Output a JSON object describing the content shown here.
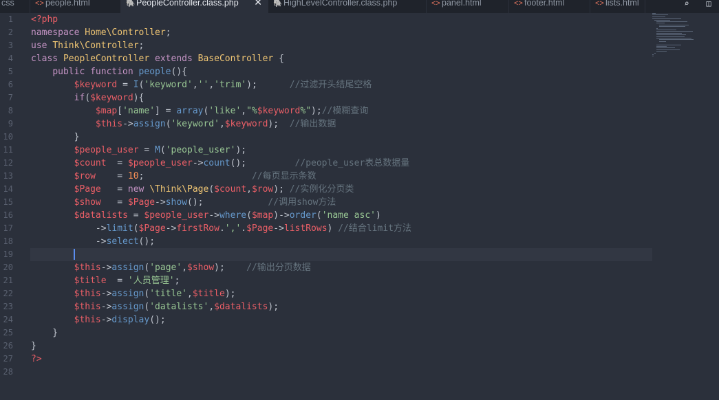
{
  "tabs": [
    {
      "label": "css",
      "icon": "",
      "active": false
    },
    {
      "label": "people.html",
      "icon": "html",
      "active": false
    },
    {
      "label": "PeopleController.class.php",
      "icon": "php",
      "active": true
    },
    {
      "label": "HighLevelController.class.php",
      "icon": "php",
      "active": false
    },
    {
      "label": "panel.html",
      "icon": "html",
      "active": false
    },
    {
      "label": "footer.html",
      "icon": "html",
      "active": false
    },
    {
      "label": "lists.html",
      "icon": "html",
      "active": false
    }
  ],
  "close_glyph": "✕",
  "html_icon_glyph": "<>",
  "php_icon_glyph": "🐘",
  "line_numbers": [
    "1",
    "2",
    "3",
    "4",
    "5",
    "6",
    "7",
    "8",
    "9",
    "10",
    "11",
    "12",
    "13",
    "14",
    "15",
    "16",
    "17",
    "18",
    "19",
    "20",
    "21",
    "22",
    "23",
    "24",
    "25",
    "26",
    "27",
    "28"
  ],
  "code_lines": [
    [
      [
        "tag",
        "<?php"
      ]
    ],
    [
      [
        "kw",
        "namespace "
      ],
      [
        "cls",
        "Home\\Controller"
      ],
      [
        "plain",
        ";"
      ]
    ],
    [
      [
        "kw",
        "use "
      ],
      [
        "cls",
        "Think\\Controller"
      ],
      [
        "plain",
        ";"
      ]
    ],
    [
      [
        "kw",
        "class "
      ],
      [
        "cls",
        "PeopleController "
      ],
      [
        "kw",
        "extends "
      ],
      [
        "cls",
        "BaseController "
      ],
      [
        "plain",
        "{"
      ]
    ],
    [
      [
        "plain",
        "    "
      ],
      [
        "kw",
        "public function "
      ],
      [
        "fn",
        "people"
      ],
      [
        "plain",
        "(){"
      ]
    ],
    [
      [
        "plain",
        "        "
      ],
      [
        "var",
        "$keyword"
      ],
      [
        "plain",
        " = "
      ],
      [
        "fn",
        "I"
      ],
      [
        "plain",
        "("
      ],
      [
        "str",
        "'keyword'"
      ],
      [
        "plain",
        ","
      ],
      [
        "str",
        "''"
      ],
      [
        "plain",
        ","
      ],
      [
        "str",
        "'trim'"
      ],
      [
        "plain",
        ");      "
      ],
      [
        "cm",
        "//过滤开头结尾空格"
      ]
    ],
    [
      [
        "plain",
        "        "
      ],
      [
        "kw",
        "if"
      ],
      [
        "plain",
        "("
      ],
      [
        "var",
        "$keyword"
      ],
      [
        "plain",
        "){"
      ]
    ],
    [
      [
        "plain",
        "            "
      ],
      [
        "var",
        "$map"
      ],
      [
        "plain",
        "["
      ],
      [
        "str",
        "'name'"
      ],
      [
        "plain",
        "] = "
      ],
      [
        "fn",
        "array"
      ],
      [
        "plain",
        "("
      ],
      [
        "str",
        "'like'"
      ],
      [
        "plain",
        ","
      ],
      [
        "str",
        "\"%"
      ],
      [
        "var",
        "$keyword"
      ],
      [
        "str",
        "%\""
      ],
      [
        "plain",
        ");"
      ],
      [
        "cm",
        "//模糊查询"
      ]
    ],
    [
      [
        "plain",
        "            "
      ],
      [
        "var",
        "$this"
      ],
      [
        "plain",
        "->"
      ],
      [
        "fn",
        "assign"
      ],
      [
        "plain",
        "("
      ],
      [
        "str",
        "'keyword'"
      ],
      [
        "plain",
        ","
      ],
      [
        "var",
        "$keyword"
      ],
      [
        "plain",
        ");  "
      ],
      [
        "cm",
        "//输出数据"
      ]
    ],
    [
      [
        "plain",
        "        }"
      ]
    ],
    [
      [
        "plain",
        "        "
      ],
      [
        "var",
        "$people_user"
      ],
      [
        "plain",
        " = "
      ],
      [
        "fn",
        "M"
      ],
      [
        "plain",
        "("
      ],
      [
        "str",
        "'people_user'"
      ],
      [
        "plain",
        ");"
      ]
    ],
    [
      [
        "plain",
        "        "
      ],
      [
        "var",
        "$count"
      ],
      [
        "plain",
        "  = "
      ],
      [
        "var",
        "$people_user"
      ],
      [
        "plain",
        "->"
      ],
      [
        "fn",
        "count"
      ],
      [
        "plain",
        "();         "
      ],
      [
        "cm",
        "//people_user表总数据量"
      ]
    ],
    [
      [
        "plain",
        "        "
      ],
      [
        "var",
        "$row"
      ],
      [
        "plain",
        "    = "
      ],
      [
        "num",
        "10"
      ],
      [
        "plain",
        ";                    "
      ],
      [
        "cm",
        "//每页显示条数"
      ]
    ],
    [
      [
        "plain",
        "        "
      ],
      [
        "var",
        "$Page"
      ],
      [
        "plain",
        "   = "
      ],
      [
        "kw",
        "new "
      ],
      [
        "cls",
        "\\Think\\Page"
      ],
      [
        "plain",
        "("
      ],
      [
        "var",
        "$count"
      ],
      [
        "plain",
        ","
      ],
      [
        "var",
        "$row"
      ],
      [
        "plain",
        "); "
      ],
      [
        "cm",
        "//实例化分页类"
      ]
    ],
    [
      [
        "plain",
        "        "
      ],
      [
        "var",
        "$show"
      ],
      [
        "plain",
        "   = "
      ],
      [
        "var",
        "$Page"
      ],
      [
        "plain",
        "->"
      ],
      [
        "fn",
        "show"
      ],
      [
        "plain",
        "();            "
      ],
      [
        "cm",
        "//调用show方法"
      ]
    ],
    [
      [
        "plain",
        "        "
      ],
      [
        "var",
        "$datalists"
      ],
      [
        "plain",
        " = "
      ],
      [
        "var",
        "$people_user"
      ],
      [
        "plain",
        "->"
      ],
      [
        "fn",
        "where"
      ],
      [
        "plain",
        "("
      ],
      [
        "var",
        "$map"
      ],
      [
        "plain",
        ")->"
      ],
      [
        "fn",
        "order"
      ],
      [
        "plain",
        "("
      ],
      [
        "str",
        "'name asc'"
      ],
      [
        "plain",
        ")"
      ]
    ],
    [
      [
        "plain",
        "            ->"
      ],
      [
        "fn",
        "limit"
      ],
      [
        "plain",
        "("
      ],
      [
        "var",
        "$Page"
      ],
      [
        "plain",
        "->"
      ],
      [
        "var",
        "firstRow"
      ],
      [
        "plain",
        "."
      ],
      [
        "str",
        "','"
      ],
      [
        "plain",
        "."
      ],
      [
        "var",
        "$Page"
      ],
      [
        "plain",
        "->"
      ],
      [
        "var",
        "listRows"
      ],
      [
        "plain",
        ") "
      ],
      [
        "cm",
        "//结合limit方法"
      ]
    ],
    [
      [
        "plain",
        "            ->"
      ],
      [
        "fn",
        "select"
      ],
      [
        "plain",
        "();"
      ]
    ],
    [
      [
        "plain",
        ""
      ]
    ],
    [
      [
        "plain",
        "        "
      ],
      [
        "var",
        "$this"
      ],
      [
        "plain",
        "->"
      ],
      [
        "fn",
        "assign"
      ],
      [
        "plain",
        "("
      ],
      [
        "str",
        "'page'"
      ],
      [
        "plain",
        ","
      ],
      [
        "var",
        "$show"
      ],
      [
        "plain",
        ");    "
      ],
      [
        "cm",
        "//输出分页数据"
      ]
    ],
    [
      [
        "plain",
        "        "
      ],
      [
        "var",
        "$title"
      ],
      [
        "plain",
        "  = "
      ],
      [
        "str",
        "'人员管理'"
      ],
      [
        "plain",
        ";"
      ]
    ],
    [
      [
        "plain",
        "        "
      ],
      [
        "var",
        "$this"
      ],
      [
        "plain",
        "->"
      ],
      [
        "fn",
        "assign"
      ],
      [
        "plain",
        "("
      ],
      [
        "str",
        "'title'"
      ],
      [
        "plain",
        ","
      ],
      [
        "var",
        "$title"
      ],
      [
        "plain",
        ");"
      ]
    ],
    [
      [
        "plain",
        "        "
      ],
      [
        "var",
        "$this"
      ],
      [
        "plain",
        "->"
      ],
      [
        "fn",
        "assign"
      ],
      [
        "plain",
        "("
      ],
      [
        "str",
        "'datalists'"
      ],
      [
        "plain",
        ","
      ],
      [
        "var",
        "$datalists"
      ],
      [
        "plain",
        ");"
      ]
    ],
    [
      [
        "plain",
        "        "
      ],
      [
        "var",
        "$this"
      ],
      [
        "plain",
        "->"
      ],
      [
        "fn",
        "display"
      ],
      [
        "plain",
        "();"
      ]
    ],
    [
      [
        "plain",
        "    }"
      ]
    ],
    [
      [
        "plain",
        "}"
      ]
    ],
    [
      [
        "tag",
        "?>"
      ]
    ],
    [
      [
        "plain",
        ""
      ]
    ]
  ],
  "top_icons": [
    {
      "name": "search-in-files-icon",
      "glyph": "⌕"
    },
    {
      "name": "split-layout-icon",
      "glyph": "◫"
    }
  ]
}
